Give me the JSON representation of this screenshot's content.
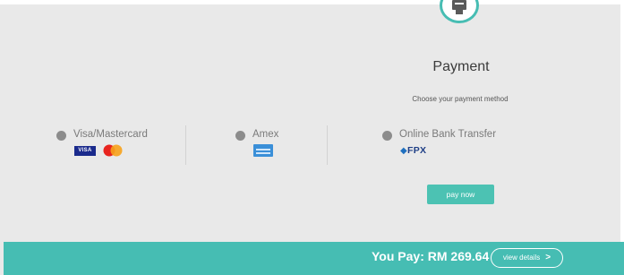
{
  "header": {
    "title": "Payment",
    "subtitle": "Choose your payment method"
  },
  "methods": [
    {
      "label": "Visa/Mastercard",
      "logos": [
        "visa-logo",
        "mastercard-logo"
      ]
    },
    {
      "label": "Amex",
      "logos": [
        "amex-logo"
      ]
    },
    {
      "label": "Online Bank Transfer",
      "logos": [
        "fpx-logo"
      ],
      "logo_text": "FPX"
    }
  ],
  "visa_text": "VISA",
  "pay_button": {
    "label": "pay now"
  },
  "footer": {
    "amount_text": "You Pay: RM 269.64",
    "details_label": "view details"
  },
  "colors": {
    "accent": "#46bdb3",
    "button": "#4cc2b3",
    "background": "#e9e9e9",
    "radio": "#8c8c8c"
  }
}
